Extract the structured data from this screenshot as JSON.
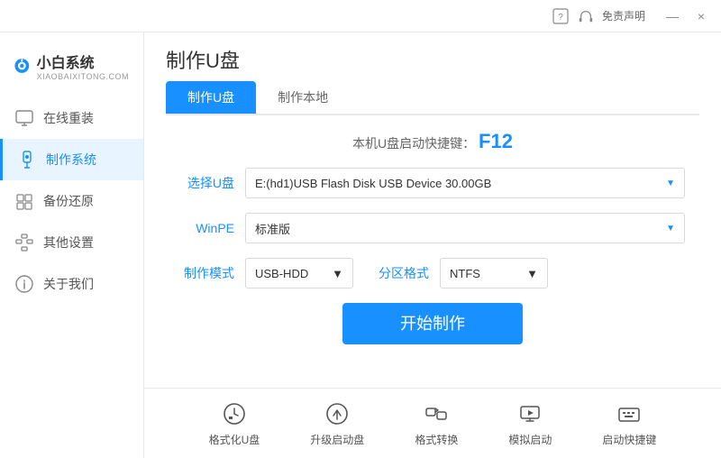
{
  "titlebar": {
    "free_declaration": "免责声明",
    "minimize": "—",
    "close": "×"
  },
  "logo": {
    "title": "小白系统",
    "subtitle": "XIAOBAIXITONG.COM"
  },
  "sidebar": {
    "items": [
      {
        "label": "在线重装",
        "icon": "monitor-icon",
        "active": false
      },
      {
        "label": "制作系统",
        "icon": "usb-icon",
        "active": true
      },
      {
        "label": "备份还原",
        "icon": "backup-icon",
        "active": false
      },
      {
        "label": "其他设置",
        "icon": "settings-icon",
        "active": false
      },
      {
        "label": "关于我们",
        "icon": "info-icon",
        "active": false
      }
    ]
  },
  "page": {
    "title": "制作U盘",
    "tabs": [
      {
        "label": "制作U盘",
        "active": true
      },
      {
        "label": "制作本地",
        "active": false
      }
    ],
    "shortcut_hint": "本机U盘启动快捷键：",
    "shortcut_key": "F12",
    "form": {
      "usb_label": "选择U盘",
      "usb_value": "E:(hd1)USB Flash Disk USB Device 30.00GB",
      "winpe_label": "WinPE",
      "winpe_value": "标准版",
      "mode_label": "制作模式",
      "mode_value": "USB-HDD",
      "partition_label": "分区格式",
      "partition_value": "NTFS",
      "start_btn": "开始制作"
    }
  },
  "toolbar": {
    "items": [
      {
        "label": "格式化U盘",
        "icon": "format-icon"
      },
      {
        "label": "升级启动盘",
        "icon": "upgrade-icon"
      },
      {
        "label": "格式转换",
        "icon": "convert-icon"
      },
      {
        "label": "模拟启动",
        "icon": "simulate-icon"
      },
      {
        "label": "启动快捷键",
        "icon": "keyboard-icon"
      }
    ]
  }
}
